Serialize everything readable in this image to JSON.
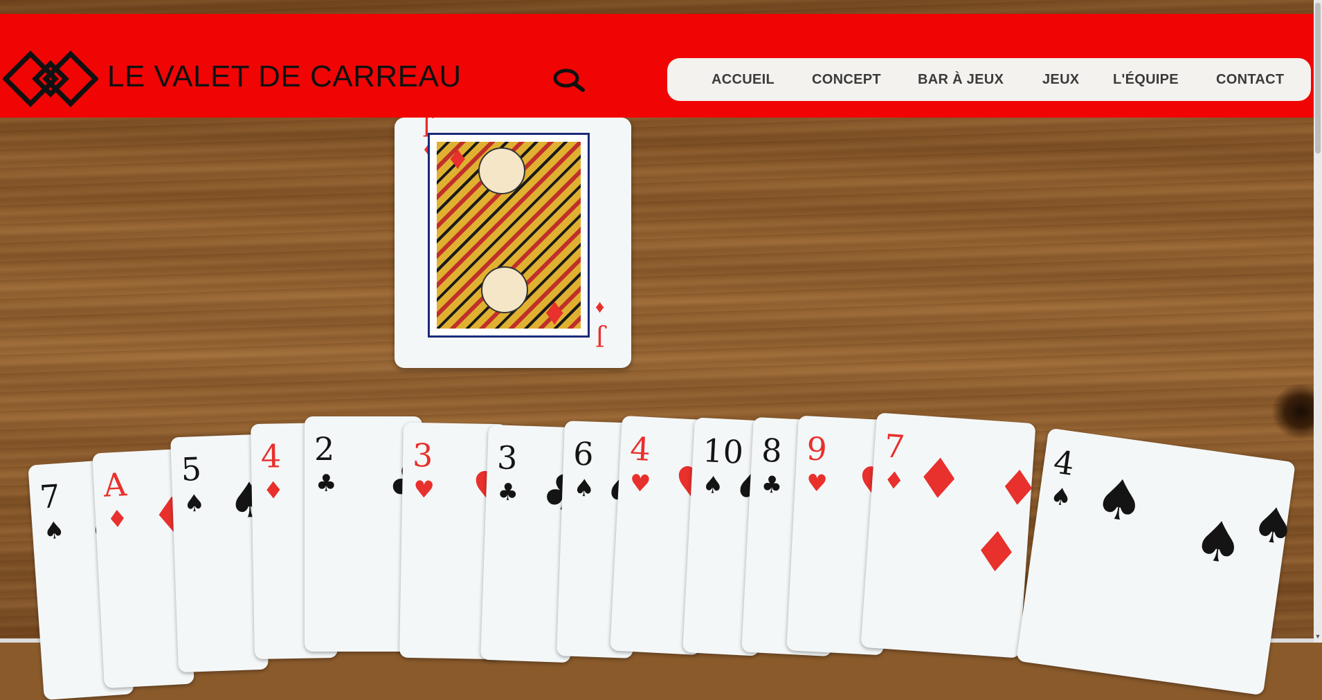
{
  "brand": {
    "name": "LE VALET DE CARREAU"
  },
  "header": {
    "search_icon": "search-icon",
    "accent_color": "#f10404"
  },
  "nav": {
    "items": [
      {
        "label": "ACCUEIL"
      },
      {
        "label": "CONCEPT"
      },
      {
        "label": "BAR À JEUX"
      },
      {
        "label": "JEUX"
      },
      {
        "label": "L'ÉQUIPE"
      },
      {
        "label": "CONTACT"
      }
    ]
  },
  "hero": {
    "featured_card": {
      "rank": "J",
      "suit": "♦"
    },
    "hand": [
      {
        "rank": "7",
        "suit": "♠"
      },
      {
        "rank": "A",
        "suit": "♦"
      },
      {
        "rank": "5",
        "suit": "♠"
      },
      {
        "rank": "4",
        "suit": "♦"
      },
      {
        "rank": "2",
        "suit": "♣"
      },
      {
        "rank": "3",
        "suit": "♥"
      },
      {
        "rank": "3",
        "suit": "♣"
      },
      {
        "rank": "6",
        "suit": "♠"
      },
      {
        "rank": "4",
        "suit": "♥"
      },
      {
        "rank": "10",
        "suit": "♠"
      },
      {
        "rank": "8",
        "suit": "♣"
      },
      {
        "rank": "9",
        "suit": "♥"
      },
      {
        "rank": "7",
        "suit": "♦"
      },
      {
        "rank": "4",
        "suit": "♠"
      }
    ]
  }
}
